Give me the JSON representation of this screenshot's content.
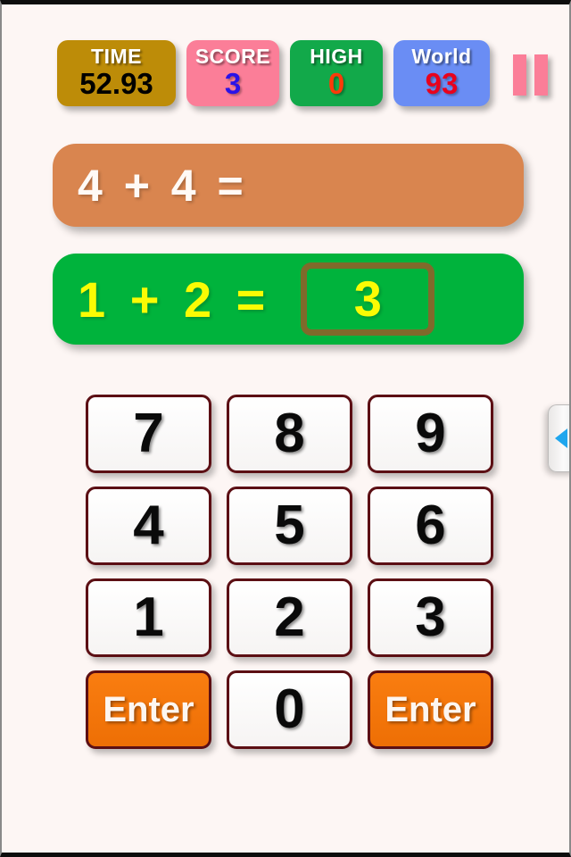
{
  "stats": [
    {
      "id": "time",
      "label": "TIME",
      "value": "52.93",
      "bg": "#bd8c08",
      "value_color": "#000000"
    },
    {
      "id": "score",
      "label": "SCORE",
      "value": "3",
      "bg": "#fb7e98",
      "value_color": "#2a12e8"
    },
    {
      "id": "high",
      "label": "HIGH",
      "value": "0",
      "bg": "#12a94a",
      "value_color": "#fc3a09"
    },
    {
      "id": "world",
      "label": "World",
      "value": "93",
      "bg": "#6a8df4",
      "value_color": "#e8021d"
    }
  ],
  "pause": {
    "icon": "pause-icon",
    "color": "#fb7e98"
  },
  "previous_problem": {
    "expression": "4 + 4 =",
    "answer": "",
    "bg": "#d9854f",
    "text_color": "#fffaf6"
  },
  "current_problem": {
    "expression": "1 + 2 =",
    "answer": "3",
    "bg": "#00b33c",
    "text_color": "#fbfb04",
    "answer_border_color": "#7f6a2b"
  },
  "keypad": [
    {
      "key": "7",
      "type": "digit"
    },
    {
      "key": "8",
      "type": "digit"
    },
    {
      "key": "9",
      "type": "digit"
    },
    {
      "key": "4",
      "type": "digit"
    },
    {
      "key": "5",
      "type": "digit"
    },
    {
      "key": "6",
      "type": "digit"
    },
    {
      "key": "1",
      "type": "digit"
    },
    {
      "key": "2",
      "type": "digit"
    },
    {
      "key": "3",
      "type": "digit"
    },
    {
      "key": "Enter",
      "type": "enter"
    },
    {
      "key": "0",
      "type": "digit"
    },
    {
      "key": "Enter",
      "type": "enter"
    }
  ],
  "drawer_handle": {
    "icon": "triangle-left-icon",
    "color": "#1fa6ee"
  },
  "theme": {
    "background": "#fdf6f4",
    "key_border": "#5c0f14",
    "enter_bg": "#f97d10"
  }
}
